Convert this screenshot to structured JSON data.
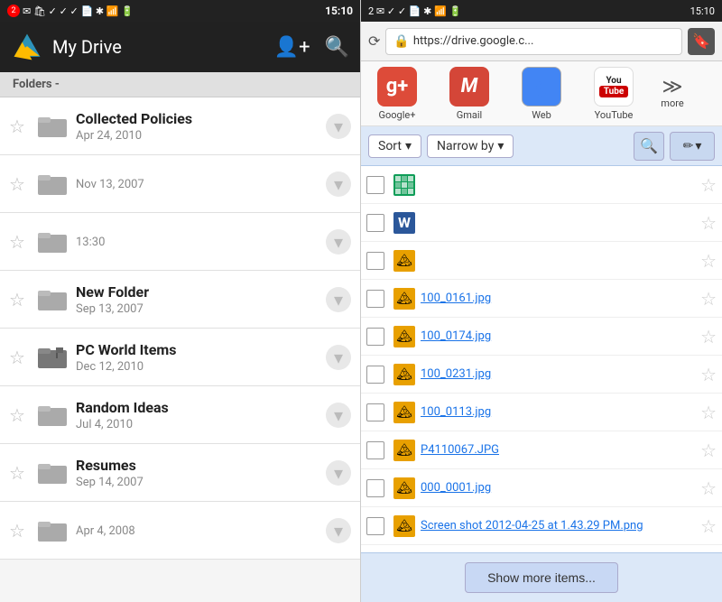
{
  "left": {
    "statusBar": {
      "badge": "2",
      "time": "15:10"
    },
    "appBar": {
      "title": "My Drive"
    },
    "foldersHeader": "Folders -",
    "folders": [
      {
        "name": "Collected Policies",
        "date": "Apr 24, 2010",
        "flagged": false
      },
      {
        "name": "",
        "date": "Nov 13, 2007",
        "flagged": false
      },
      {
        "name": "",
        "date": "13:30",
        "flagged": false
      },
      {
        "name": "New Folder",
        "date": "Sep 13, 2007",
        "flagged": false
      },
      {
        "name": "PC World Items",
        "date": "Dec 12, 2010",
        "flagged": true
      },
      {
        "name": "Random Ideas",
        "date": "Jul 4, 2010",
        "flagged": false
      },
      {
        "name": "Resumes",
        "date": "Sep 14, 2007",
        "flagged": false
      },
      {
        "name": "",
        "date": "Apr 4, 2008",
        "flagged": false
      }
    ]
  },
  "right": {
    "statusBar": {
      "badge": "2",
      "time": "15:10"
    },
    "browserBar": {
      "url": "https://drive.google.c..."
    },
    "bookmarks": [
      {
        "id": "gplus",
        "label": "Google+"
      },
      {
        "id": "gmail",
        "label": "Gmail"
      },
      {
        "id": "gweb",
        "label": "Web"
      },
      {
        "id": "youtube",
        "label": "YouTube"
      },
      {
        "id": "more",
        "label": "more"
      }
    ],
    "toolbar": {
      "sortLabel": "Sort",
      "narrowLabel": "Narrow by"
    },
    "files": [
      {
        "type": "sheets",
        "name": ""
      },
      {
        "type": "word",
        "name": ""
      },
      {
        "type": "image",
        "name": ""
      },
      {
        "type": "image",
        "name": "100_0161.jpg"
      },
      {
        "type": "image",
        "name": "100_0174.jpg"
      },
      {
        "type": "image",
        "name": "100_0231.jpg"
      },
      {
        "type": "image",
        "name": "100_0113.jpg"
      },
      {
        "type": "image",
        "name": "P4110067.JPG"
      },
      {
        "type": "image",
        "name": "000_0001.jpg"
      },
      {
        "type": "image",
        "name": "Screen shot 2012-04-25 at 1.43.29 PM.png"
      }
    ],
    "showMoreLabel": "Show more items..."
  }
}
